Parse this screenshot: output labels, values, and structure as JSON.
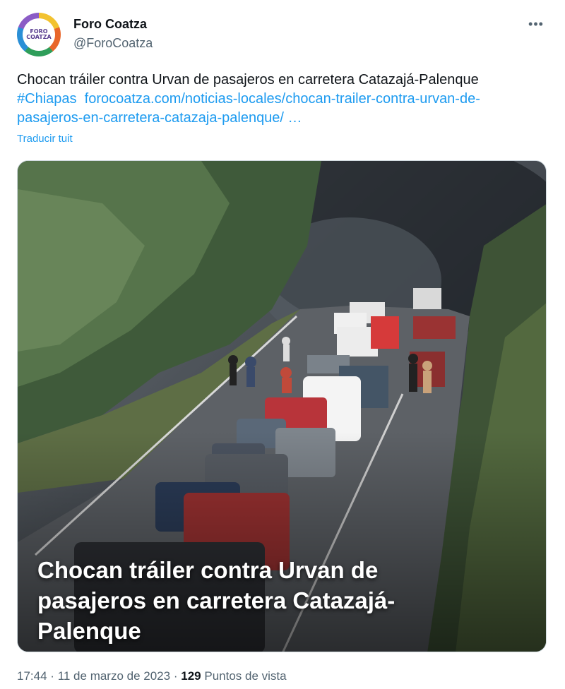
{
  "author": {
    "name": "Foro Coatza",
    "handle": "@ForoCoatza",
    "avatar_text": "FORO COATZA"
  },
  "more_icon": "more-horizontal-icon",
  "tweet": {
    "text": "Chocan tráiler contra Urvan de pasajeros en carretera Catazajá-Palenque",
    "hashtag": "#Chiapas",
    "url": "forocoatza.com/noticias-locales/chocan-trailer-contra-urvan-de-pasajeros-en-carretera-catazaja-palenque/ …",
    "translate_label": "Traducir tuit"
  },
  "media": {
    "caption": "Chocan tráiler contra Urvan de pasajeros en carretera Catazajá-Palenque"
  },
  "meta": {
    "time": "17:44",
    "separator": "·",
    "date": "11 de marzo de 2023",
    "views_count": "129",
    "views_label": "Puntos de vista"
  },
  "colors": {
    "link": "#1d9bf0",
    "secondary_text": "#536471",
    "primary_text": "#0f1419"
  }
}
